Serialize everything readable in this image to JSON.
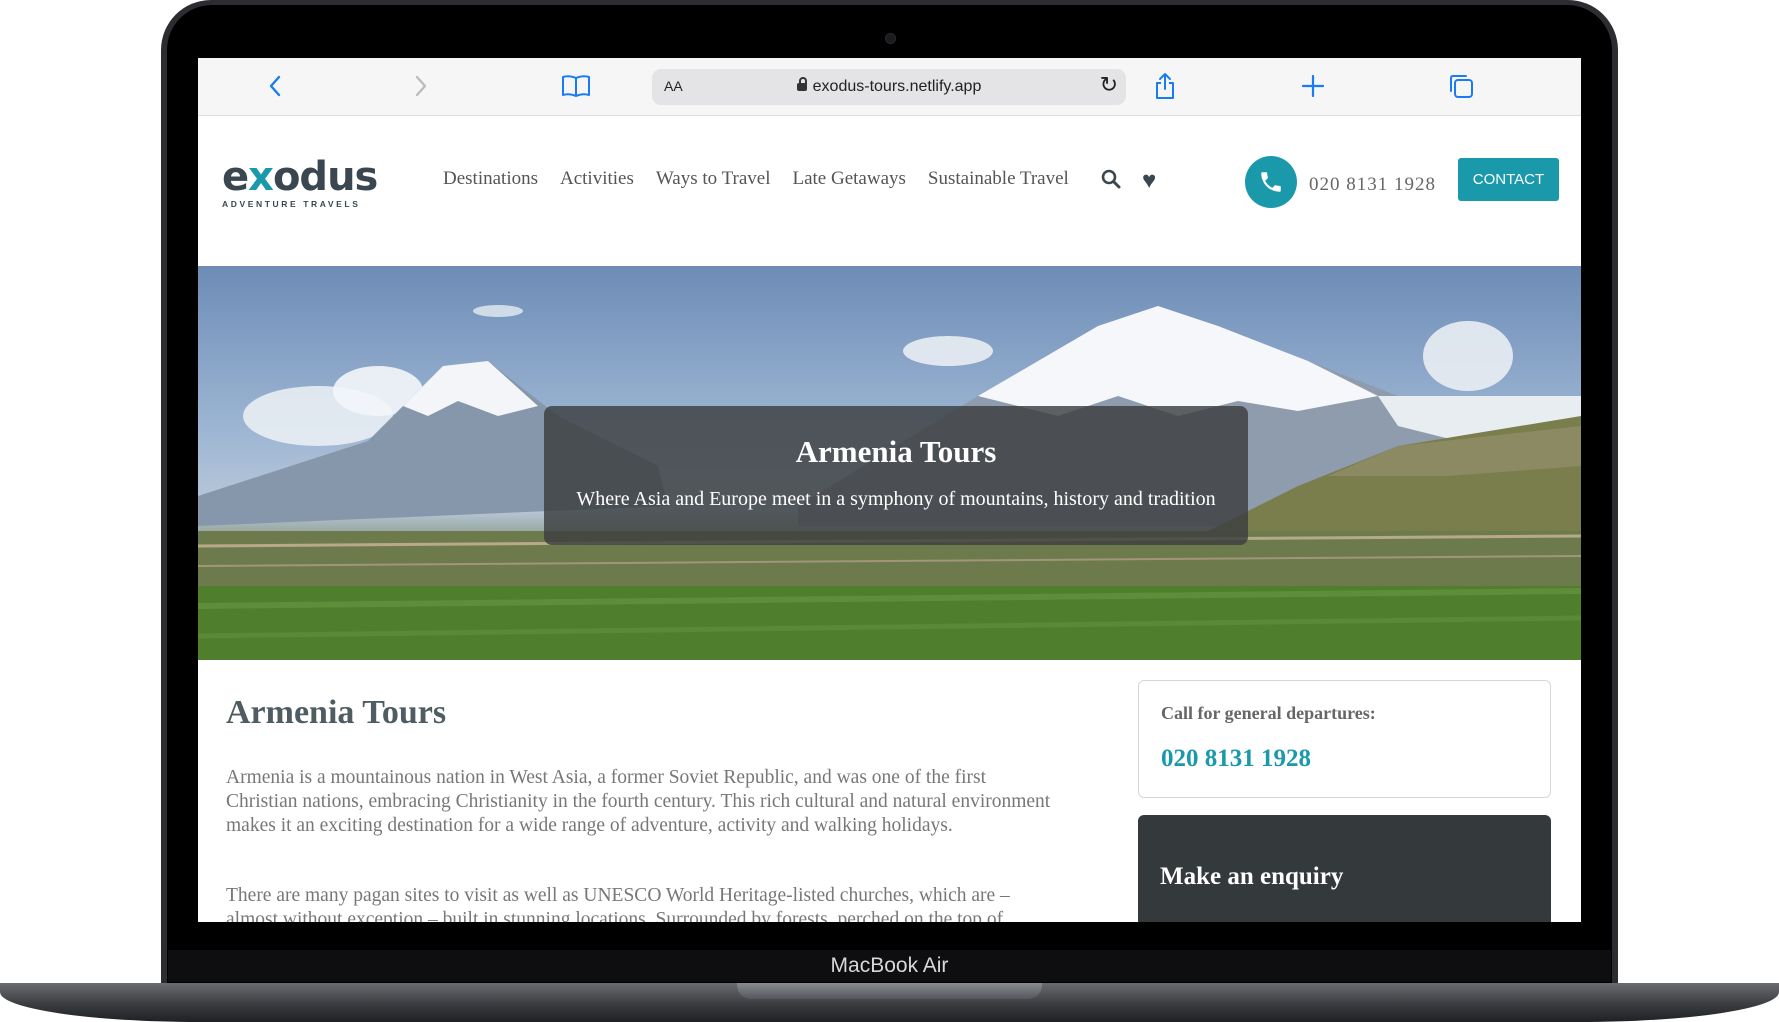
{
  "device": {
    "model_label": "MacBook Air"
  },
  "browser": {
    "text_size_label": "AA",
    "url": "exodus-tours.netlify.app"
  },
  "site": {
    "logo_text": "exodus",
    "logo_tagline": "ADVENTURE TRAVELS",
    "nav": [
      {
        "label": "Destinations"
      },
      {
        "label": "Activities"
      },
      {
        "label": "Ways to Travel"
      },
      {
        "label": "Late Getaways"
      },
      {
        "label": "Sustainable Travel"
      }
    ],
    "phone": "020 8131 1928",
    "contact_label": "CONTACT",
    "accent_color": "#1a99ab"
  },
  "hero": {
    "title": "Armenia Tours",
    "subtitle": "Where Asia and Europe meet in a symphony of mountains, history and tradition"
  },
  "main": {
    "title": "Armenia Tours",
    "paragraph1": "Armenia is a mountainous nation in West Asia, a former Soviet Republic, and was one of the first Christian nations, embracing Christianity in the fourth century. This rich cultural and natural environment makes it an exciting destination for a wide range of adventure, activity and walking holidays.",
    "paragraph2": "There are many pagan sites to visit as well as UNESCO World Heritage-listed churches, which are – almost without exception – built in stunning locations. Surrounded by forests, perched on the top of"
  },
  "sidebar": {
    "call_label": "Call for general departures:",
    "call_number": "020 8131 1928",
    "enquiry_title": "Make an enquiry"
  }
}
